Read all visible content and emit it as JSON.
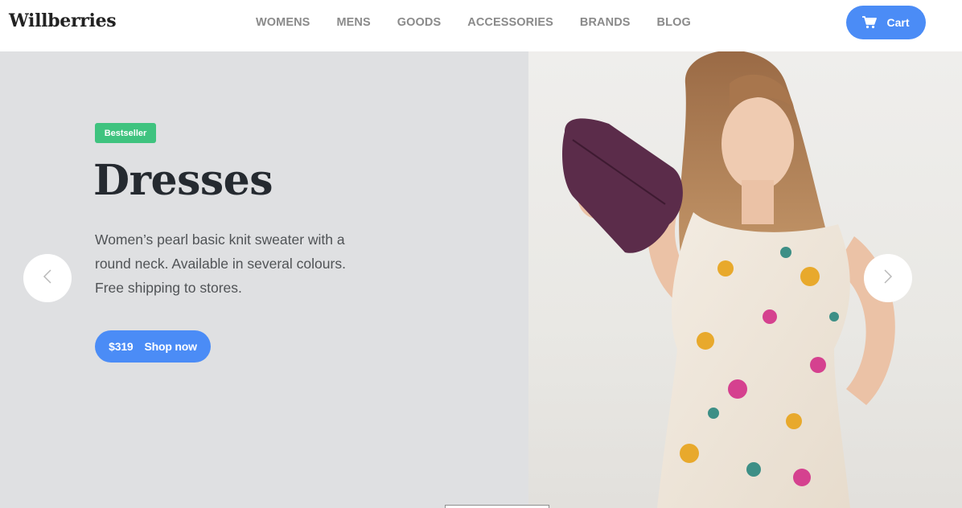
{
  "header": {
    "logo": "Willberries",
    "nav": [
      "WOMENS",
      "MENS",
      "GOODS",
      "ACCESSORIES",
      "BRANDS",
      "BLOG"
    ],
    "cart_label": "Cart",
    "cart_icon": "shopping-cart-icon"
  },
  "slide": {
    "badge": "Bestseller",
    "title": "Dresses",
    "description": "Women’s pearl basic knit sweater with a round neck. Available in several colours. Free shipping to stores.",
    "price": "$319",
    "button_label": "Shop now",
    "image_subject": "woman in floral dress holding purple clutch"
  },
  "colors": {
    "accent": "#4b8cf6",
    "badge": "#3fc37f",
    "slide_bg": "#dfe0e2",
    "title": "#252a30",
    "nav_text": "#8a8a8a"
  },
  "icons": {
    "prev": "chevron-left-icon",
    "next": "chevron-right-icon"
  }
}
